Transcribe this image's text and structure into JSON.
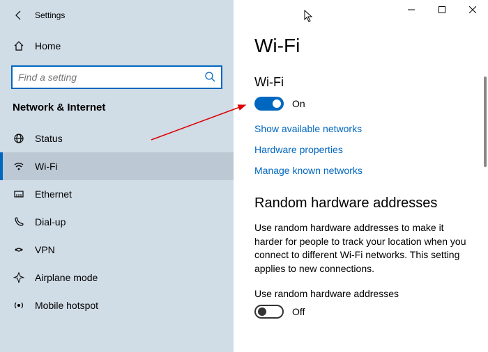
{
  "app_title": "Settings",
  "home_label": "Home",
  "search_placeholder": "Find a setting",
  "section_header": "Network & Internet",
  "nav_items": [
    {
      "label": "Status"
    },
    {
      "label": "Wi-Fi"
    },
    {
      "label": "Ethernet"
    },
    {
      "label": "Dial-up"
    },
    {
      "label": "VPN"
    },
    {
      "label": "Airplane mode"
    },
    {
      "label": "Mobile hotspot"
    }
  ],
  "main": {
    "title": "Wi-Fi",
    "wifi_label": "Wi-Fi",
    "wifi_toggle_state": "On",
    "links": [
      "Show available networks",
      "Hardware properties",
      "Manage known networks"
    ],
    "random_header": "Random hardware addresses",
    "random_description": "Use random hardware addresses to make it harder for people to track your location when you connect to different Wi-Fi networks. This setting applies to new connections.",
    "use_random_label": "Use random hardware addresses",
    "use_random_toggle_state": "Off"
  }
}
